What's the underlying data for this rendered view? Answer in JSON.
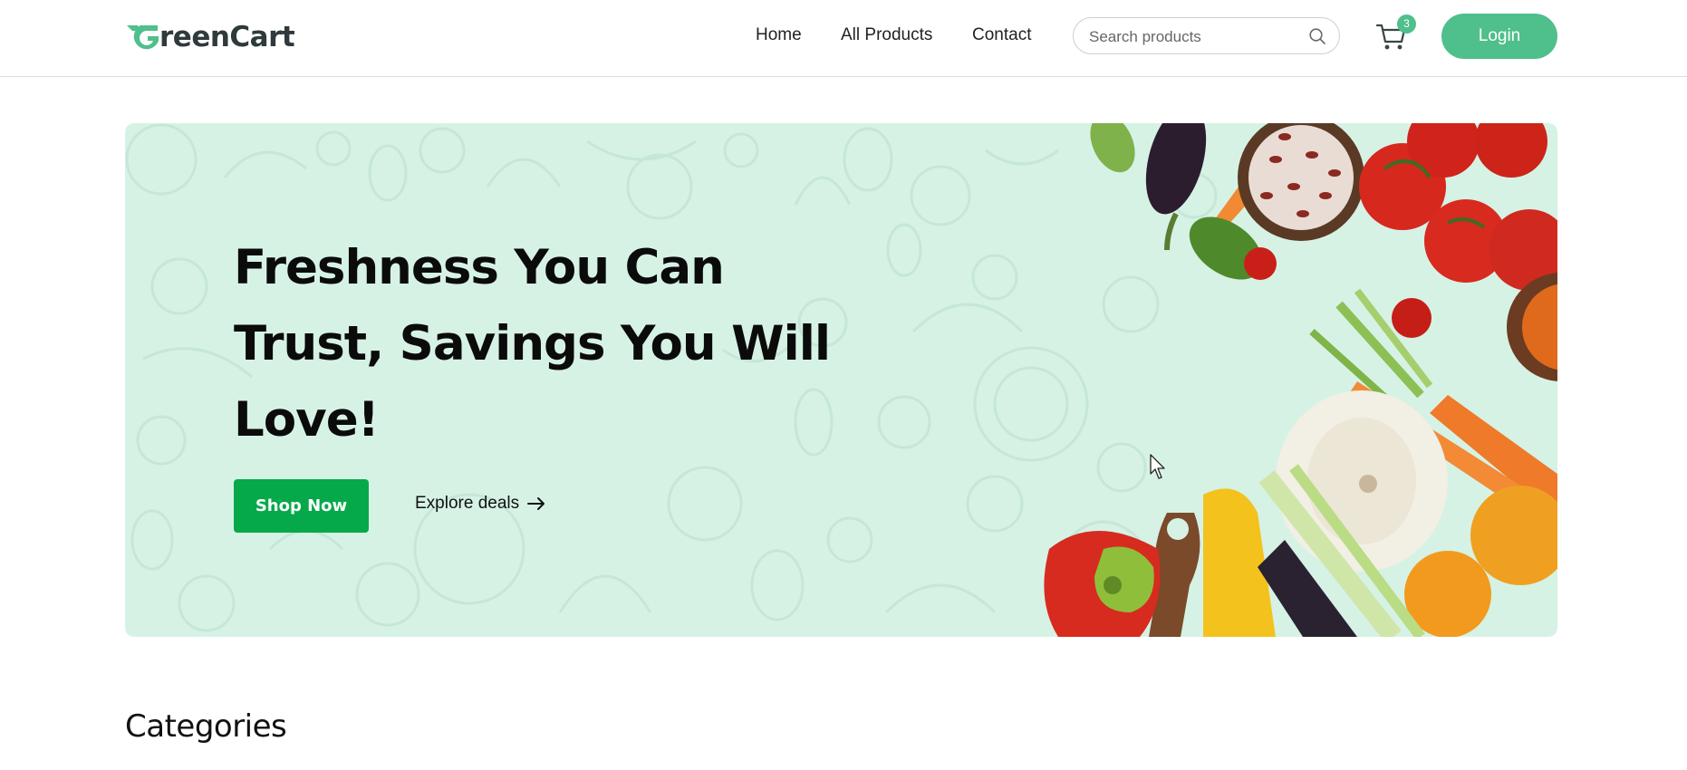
{
  "brand": {
    "name": "reenCart",
    "accent": "#4fbf8b"
  },
  "nav": {
    "links": [
      "Home",
      "All Products",
      "Contact"
    ],
    "search_placeholder": "Search products",
    "cart_count": "3",
    "login_label": "Login"
  },
  "hero": {
    "title": "Freshness You Can Trust, Savings You Will Love!",
    "primary_button": "Shop Now",
    "secondary_link": "Explore deals",
    "background": "#d6f2e5",
    "button_color": "#06a94a"
  },
  "sections": {
    "categories_title": "Categories"
  },
  "icons": {
    "search": "search-icon",
    "cart": "cart-icon",
    "arrow": "arrow-right-icon",
    "logo": "g-logo-icon"
  }
}
